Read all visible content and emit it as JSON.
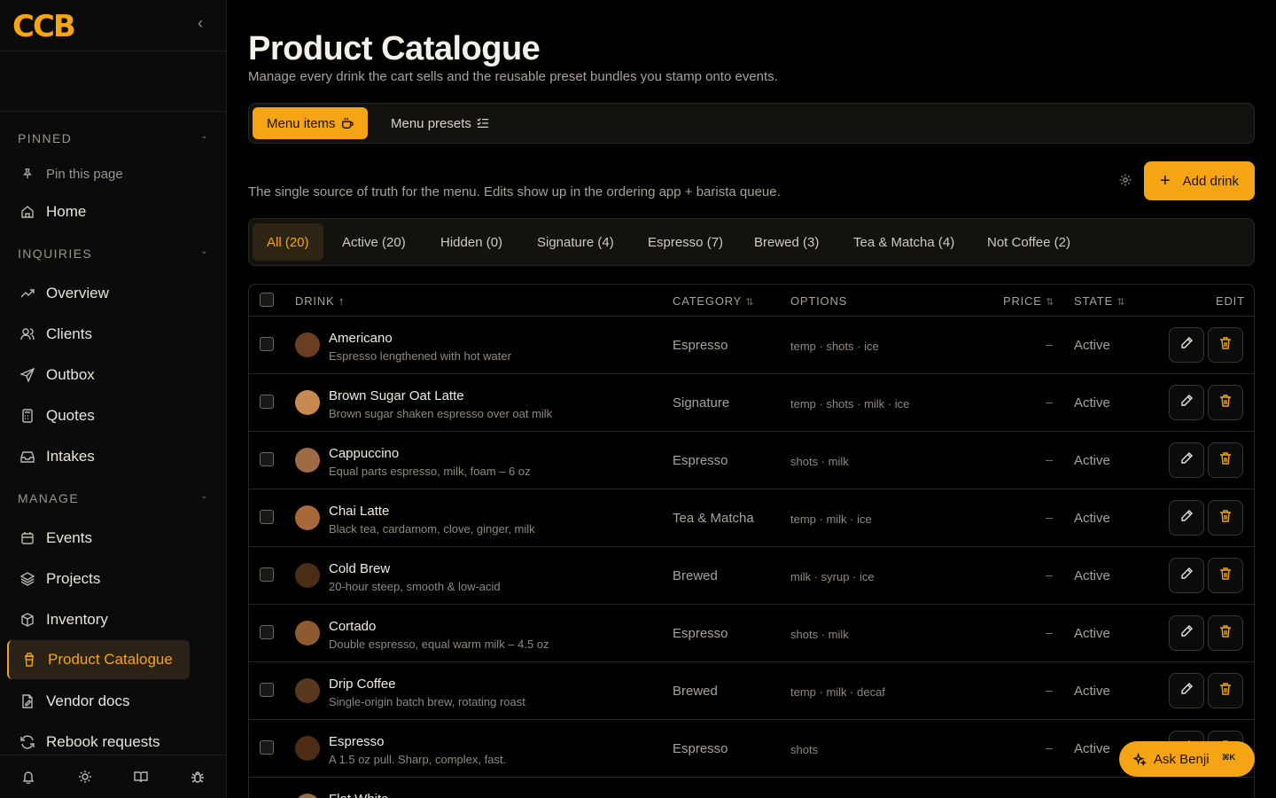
{
  "brand": {
    "logo_text": "CCB",
    "accent": "#f5a513"
  },
  "sidebar": {
    "sections": {
      "pinned": "PINNED",
      "inquiries": "INQUIRIES",
      "manage": "MANAGE"
    },
    "pin_this_page": "Pin this page",
    "home": "Home",
    "inquiries_items": [
      "Overview",
      "Clients",
      "Outbox",
      "Quotes",
      "Intakes"
    ],
    "manage_items": [
      "Events",
      "Projects",
      "Inventory",
      "Product Catalogue",
      "Vendor docs",
      "Rebook requests"
    ],
    "active_item": "Product Catalogue"
  },
  "page": {
    "title": "Product Catalogue",
    "subtitle": "Manage every drink the cart sells and the reusable preset bundles you stamp onto events.",
    "tabs": [
      "Menu items",
      "Menu presets"
    ],
    "description": "The single source of truth for the menu. Edits show up in the ordering app + barista queue.",
    "add_button": "Add drink"
  },
  "filters": [
    "All (20)",
    "Active (20)",
    "Hidden (0)",
    "Signature (4)",
    "Espresso (7)",
    "Brewed (3)",
    "Tea & Matcha (4)",
    "Not Coffee (2)"
  ],
  "table": {
    "headers": {
      "drink": "DRINK",
      "category": "CATEGORY",
      "options": "OPTIONS",
      "price": "PRICE",
      "state": "STATE",
      "edit": "EDIT"
    },
    "rows": [
      {
        "name": "Americano",
        "desc": "Espresso lengthened with hot water",
        "category": "Espresso",
        "options": "temp · shots · ice",
        "price": "–",
        "state": "Active",
        "color": "#6b3d22"
      },
      {
        "name": "Brown Sugar Oat Latte",
        "desc": "Brown sugar shaken espresso over oat milk",
        "category": "Signature",
        "options": "temp · shots · milk · ice",
        "price": "–",
        "state": "Active",
        "color": "#c98a52"
      },
      {
        "name": "Cappuccino",
        "desc": "Equal parts espresso, milk, foam – 6 oz",
        "category": "Espresso",
        "options": "shots · milk",
        "price": "–",
        "state": "Active",
        "color": "#a06b43"
      },
      {
        "name": "Chai Latte",
        "desc": "Black tea, cardamom, clove, ginger, milk",
        "category": "Tea & Matcha",
        "options": "temp · milk · ice",
        "price": "–",
        "state": "Active",
        "color": "#a7683a"
      },
      {
        "name": "Cold Brew",
        "desc": "20-hour steep, smooth & low-acid",
        "category": "Brewed",
        "options": "milk · syrup · ice",
        "price": "–",
        "state": "Active",
        "color": "#4a2d16"
      },
      {
        "name": "Cortado",
        "desc": "Double espresso, equal warm milk – 4.5 oz",
        "category": "Espresso",
        "options": "shots · milk",
        "price": "–",
        "state": "Active",
        "color": "#8e5a2f"
      },
      {
        "name": "Drip Coffee",
        "desc": "Single-origin batch brew, rotating roast",
        "category": "Brewed",
        "options": "temp · milk · decaf",
        "price": "–",
        "state": "Active",
        "color": "#5a3820"
      },
      {
        "name": "Espresso",
        "desc": "A 1.5 oz pull. Sharp, complex, fast.",
        "category": "Espresso",
        "options": "shots",
        "price": "–",
        "state": "Active",
        "color": "#4e2c15"
      },
      {
        "name": "Flat White",
        "desc": "",
        "category": "",
        "options": "",
        "price": "",
        "state": "",
        "color": "#9a6a3c"
      }
    ]
  },
  "assistant": {
    "label": "Ask Benji",
    "shortcut": "⌘K"
  }
}
